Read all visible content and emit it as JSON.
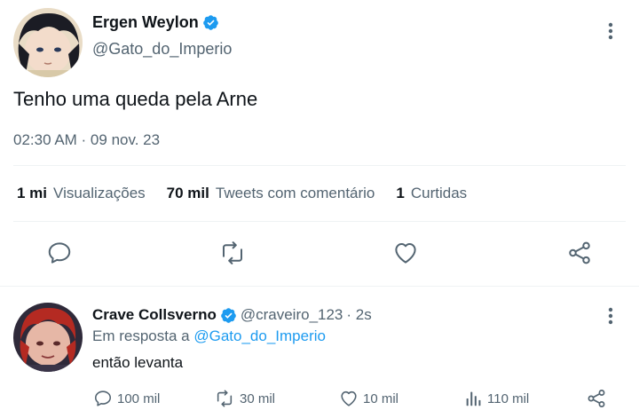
{
  "main_tweet": {
    "author": {
      "name": "Ergen Weylon",
      "handle": "@Gato_do_Imperio",
      "verified": true
    },
    "text": "Tenho uma queda pela Arne",
    "timestamp": "02:30 AM · 09 nov. 23",
    "stats": [
      {
        "value": "1 mi",
        "label": "Visualizações"
      },
      {
        "value": "70 mil",
        "label": "Tweets com comentário"
      },
      {
        "value": "1",
        "label": "Curtidas"
      }
    ],
    "actions": [
      "reply-icon",
      "retweet-icon",
      "like-icon",
      "share-icon"
    ]
  },
  "reply": {
    "author": {
      "name": "Crave Collsverno",
      "handle": "@craveiro_123",
      "time": "· 2s",
      "verified": true
    },
    "in_reply_prefix": "Em resposta a",
    "in_reply_to": "@Gato_do_Imperio",
    "text": "então levanta",
    "actions": {
      "reply": "100 mil",
      "retweet": "30 mil",
      "like": "10 mil",
      "views": "110 mil"
    }
  },
  "colors": {
    "accent": "#1d9bf0",
    "text_primary": "#0f1419",
    "text_secondary": "#536471",
    "divider": "#eff3f4"
  }
}
